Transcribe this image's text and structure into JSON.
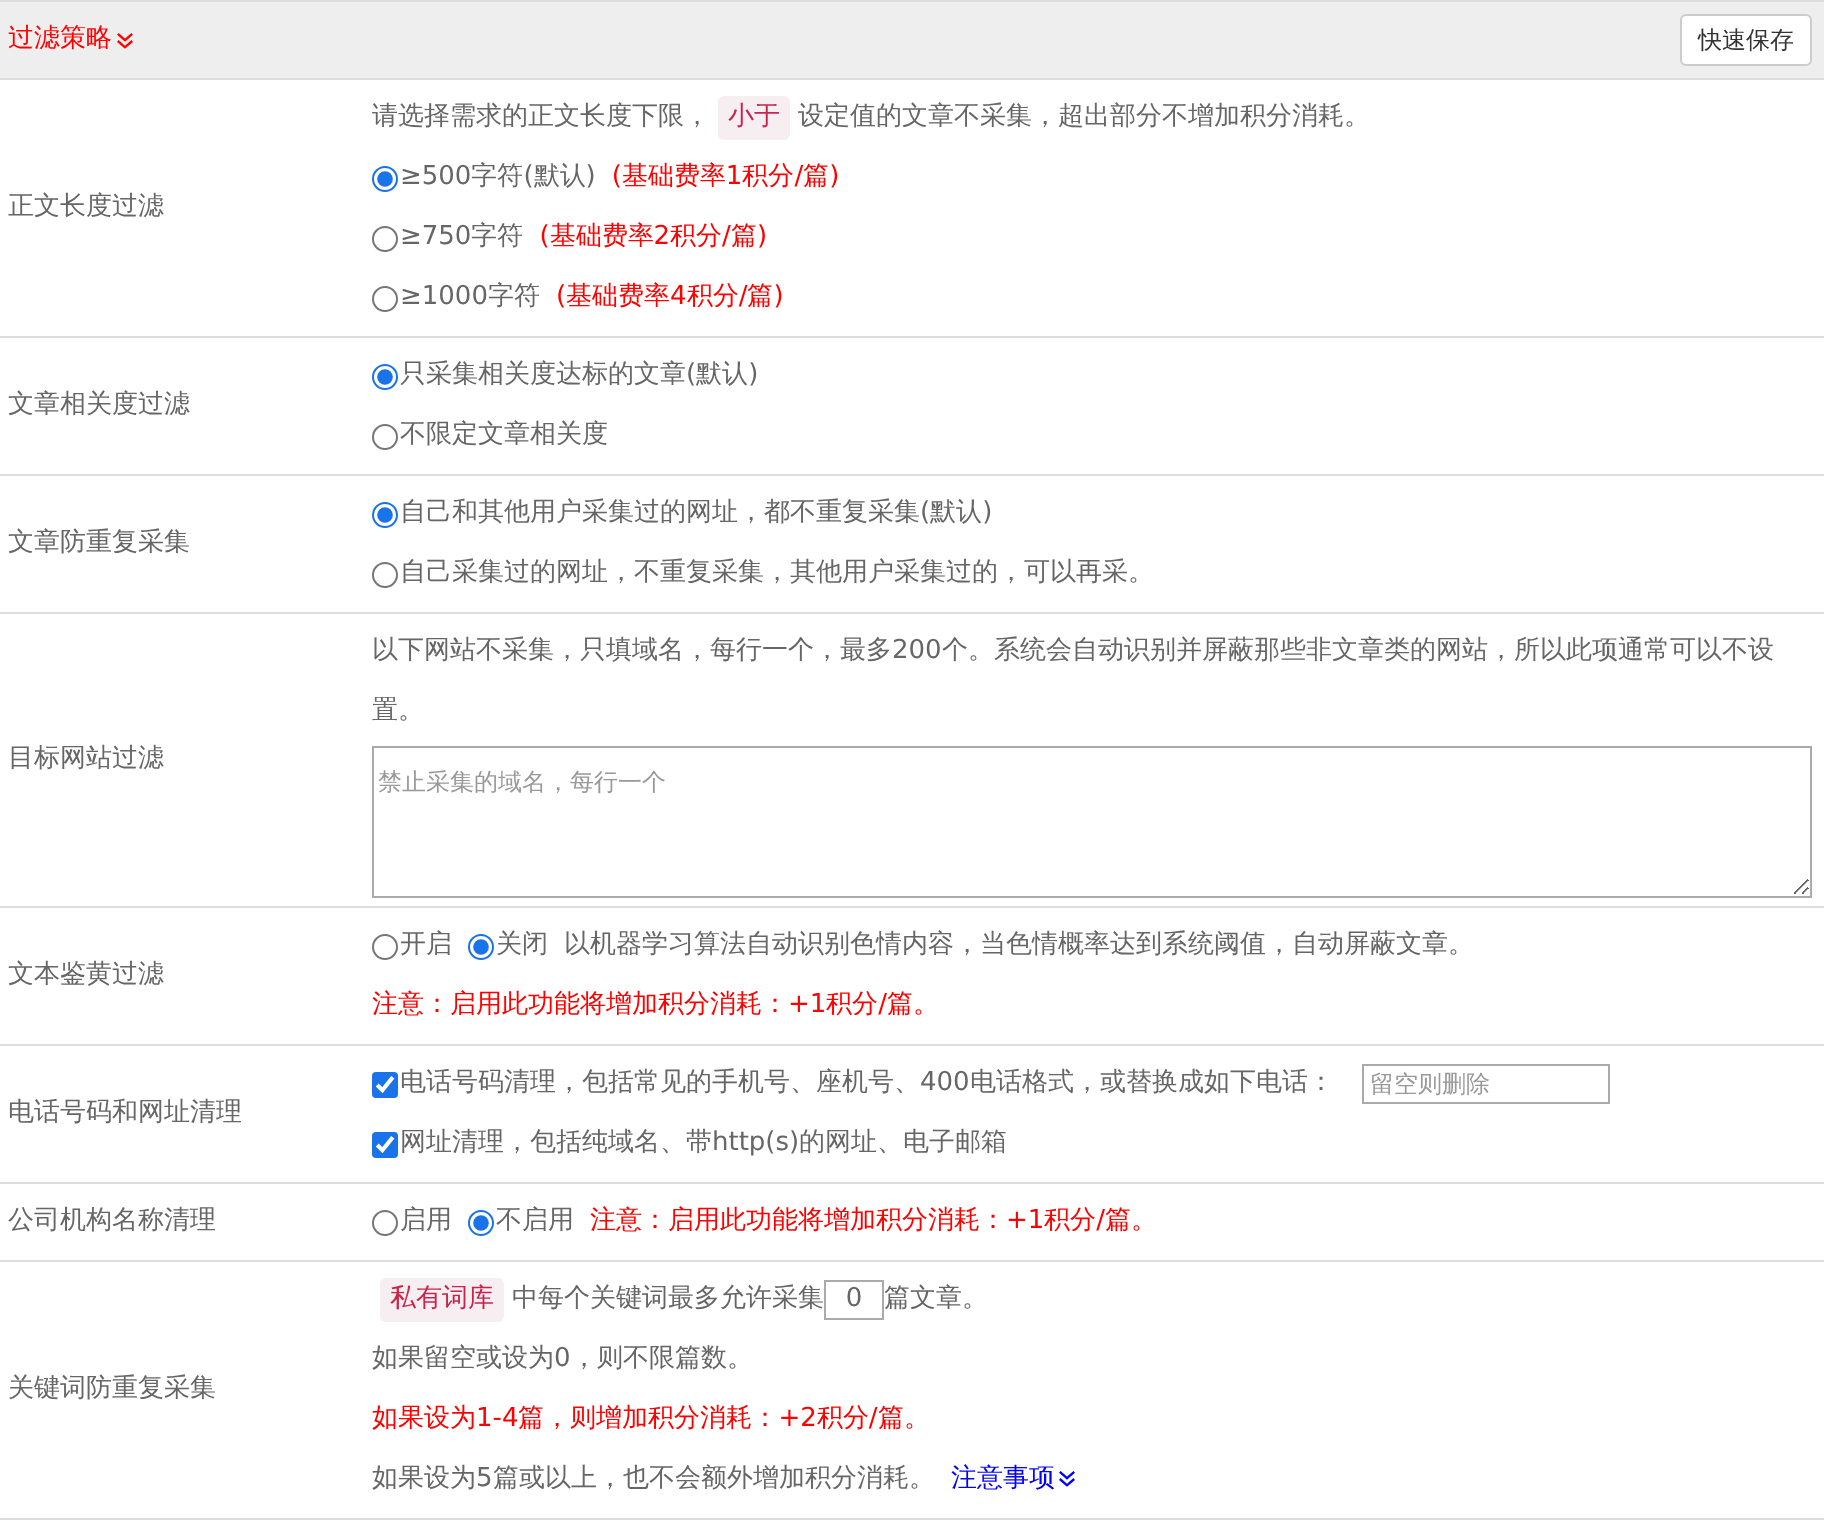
{
  "header": {
    "title": "过滤策略",
    "button": "快速保存"
  },
  "rows": [
    {
      "label": "正文长度过滤",
      "lines": [
        [
          {
            "kind": "text",
            "text": "请选择需求的正文长度下限，"
          },
          {
            "kind": "tag",
            "text": "小于"
          },
          {
            "kind": "text",
            "text": "设定值的文章不采集，超出部分不增加积分消耗。"
          }
        ],
        [
          {
            "kind": "radio",
            "text": "≥500字符(默认)",
            "selected": true
          },
          {
            "kind": "note",
            "text": "(基础费率1积分/篇)"
          }
        ],
        [
          {
            "kind": "radio",
            "text": "≥750字符",
            "selected": false
          },
          {
            "kind": "note",
            "text": "(基础费率2积分/篇)"
          }
        ],
        [
          {
            "kind": "radio",
            "text": "≥1000字符",
            "selected": false
          },
          {
            "kind": "note",
            "text": "(基础费率4积分/篇)"
          }
        ]
      ]
    },
    {
      "label": "文章相关度过滤",
      "lines": [
        [
          {
            "kind": "radio",
            "text": "只采集相关度达标的文章(默认)",
            "selected": true
          }
        ],
        [
          {
            "kind": "radio",
            "text": "不限定文章相关度",
            "selected": false
          }
        ]
      ]
    },
    {
      "label": "文章防重复采集",
      "lines": [
        [
          {
            "kind": "radio",
            "text": "自己和其他用户采集过的网址，都不重复采集(默认)",
            "selected": true
          }
        ],
        [
          {
            "kind": "radio",
            "text": "自己采集过的网址，不重复采集，其他用户采集过的，可以再采。",
            "selected": false
          }
        ]
      ]
    },
    {
      "label": "目标网站过滤",
      "lines": [
        [
          {
            "kind": "text",
            "text": "以下网站不采集，只填域名，每行一个，最多200个。系统会自动识别并屏蔽那些非文章类的网站，所以此项通常可以不设置。"
          }
        ],
        [
          {
            "kind": "textarea",
            "placeholder": "禁止采集的域名，每行一个"
          }
        ]
      ]
    },
    {
      "label": "文本鉴黄过滤",
      "lines": [
        [
          {
            "kind": "radio",
            "text": "开启",
            "selected": false
          },
          {
            "kind": "radio",
            "text": "关闭",
            "selected": true
          },
          {
            "kind": "text",
            "text": "以机器学习算法自动识别色情内容，当色情概率达到系统阈值，自动屏蔽文章。"
          }
        ],
        [
          {
            "kind": "note",
            "text": "注意：启用此功能将增加积分消耗：+1积分/篇。"
          }
        ]
      ]
    },
    {
      "label": "电话号码和网址清理",
      "lines": [
        [
          {
            "kind": "checkbox",
            "text": "电话号码清理，包括常见的手机号、座机号、400电话格式，或替换成如下电话：",
            "checked": true
          },
          {
            "kind": "input",
            "placeholder": "留空则删除"
          }
        ],
        [
          {
            "kind": "checkbox",
            "text": "网址清理，包括纯域名、带http(s)的网址、电子邮箱",
            "checked": true
          }
        ]
      ]
    },
    {
      "label": "公司机构名称清理",
      "lines": [
        [
          {
            "kind": "radio",
            "text": "启用",
            "selected": false
          },
          {
            "kind": "radio",
            "text": "不启用",
            "selected": true
          },
          {
            "kind": "note",
            "text": "注意：启用此功能将增加积分消耗：+1积分/篇。"
          }
        ]
      ]
    },
    {
      "label": "关键词防重复采集",
      "lines": [
        [
          {
            "kind": "tag",
            "text": "私有词库"
          },
          {
            "kind": "text",
            "text": "中每个关键词最多允许采集"
          },
          {
            "kind": "number",
            "value": "0"
          },
          {
            "kind": "text",
            "text": "篇文章。"
          }
        ],
        [
          {
            "kind": "text",
            "text": "如果留空或设为0，则不限篇数。"
          }
        ],
        [
          {
            "kind": "note",
            "text": "如果设为1-4篇，则增加积分消耗：+2积分/篇。"
          }
        ],
        [
          {
            "kind": "text",
            "text": "如果设为5篇或以上，也不会额外增加积分消耗。"
          },
          {
            "kind": "link",
            "text": "注意事项"
          }
        ]
      ]
    }
  ]
}
